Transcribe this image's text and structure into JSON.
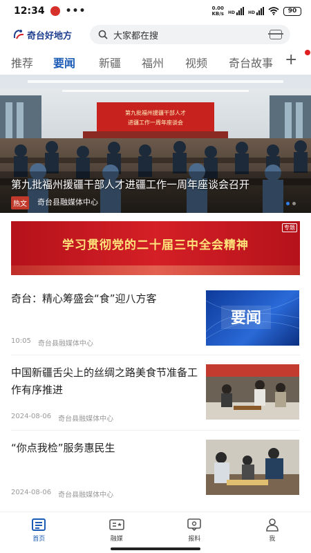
{
  "status": {
    "time": "12:34",
    "net_speed_top": "0.00",
    "net_speed_bottom": "KB/s",
    "net_type": "HD",
    "battery": "90"
  },
  "header": {
    "app_name": "奇台好地方",
    "search_placeholder": "大家都在搜"
  },
  "tabs": [
    "推荐",
    "要闻",
    "新疆",
    "福州",
    "视频",
    "奇台故事"
  ],
  "active_tab": "要闻",
  "banner": {
    "screen_text_line1": "第九批福州援疆干部人才",
    "screen_text_line2": "进疆工作一周年座谈会",
    "caption": "第九批福州援疆干部人才进疆工作一周年座谈会召开",
    "tag": "热文",
    "source": "奇台县融媒体中心"
  },
  "topic": {
    "title": "学习贯彻党的二十届三中全会精神",
    "corner": "专题"
  },
  "news": [
    {
      "title": "奇台：精心筹盛会“食”迎八方客",
      "date": "10:05",
      "source": "奇台县融媒体中心",
      "thumb_text": "要闻"
    },
    {
      "title": "中国新疆舌尖上的丝绸之路美食节准备工作有序推进",
      "date": "2024-08-06",
      "source": "奇台县融媒体中心"
    },
    {
      "title": "“你点我检”服务惠民生",
      "date": "2024-08-06",
      "source": "奇台县融媒体中心"
    }
  ],
  "bottom_nav": [
    {
      "label": "首页",
      "icon": "home-icon"
    },
    {
      "label": "融媒",
      "icon": "media-icon"
    },
    {
      "label": "报料",
      "icon": "report-icon"
    },
    {
      "label": "我",
      "icon": "user-icon"
    }
  ],
  "colors": {
    "accent": "#1a5bb5",
    "brand_red": "#d41f26",
    "gold_text": "#ffe27a"
  }
}
